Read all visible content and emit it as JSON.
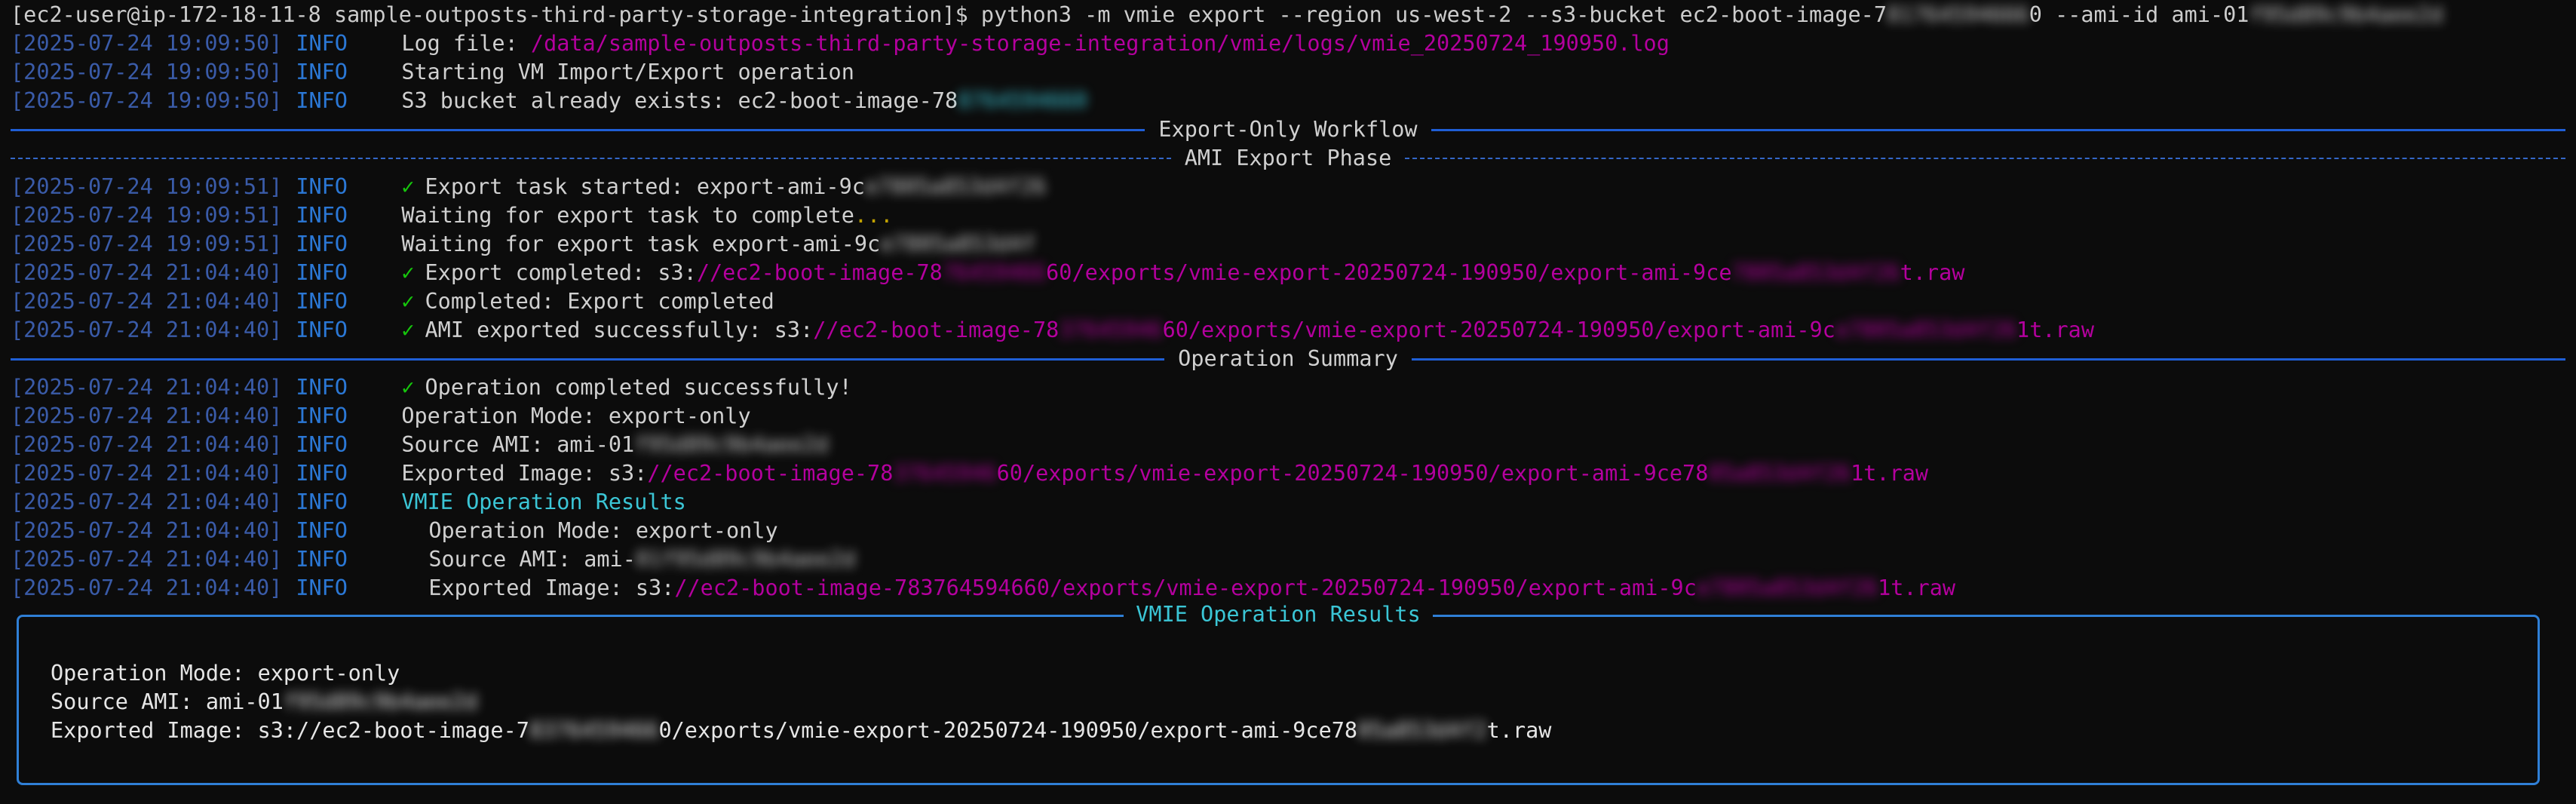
{
  "prompt": {
    "user": "[ec2-user@ip-172-18-11-8 sample-outposts-third-party-storage-integration]$",
    "command_a": "python3 -m vmie export --region us-west-2 --s3-bucket ec2-boot-image-7",
    "command_b": "0 --ami-id ami-01",
    "command_c": "f95d89c9b4aee2d"
  },
  "level": "INFO",
  "check": "✓",
  "pre": [
    {
      "ts": "[2025-07-24 19:09:50]",
      "text": "Log file: ",
      "link": "/data/sample-outposts-third-party-storage-integration/vmie/logs/vmie_20250724_190950.log"
    },
    {
      "ts": "[2025-07-24 19:09:50]",
      "text": "Starting VM Import/Export operation"
    },
    {
      "ts": "[2025-07-24 19:09:50]",
      "text": "S3 bucket already exists: ec2-boot-image-78"
    }
  ],
  "sections": {
    "workflow": "Export-Only Workflow",
    "phase": "AMI Export Phase",
    "summary": "Operation Summary"
  },
  "export_lines": {
    "l1_ts": "[2025-07-24 19:09:51]",
    "l1_text": "Export task started: export-ami-9c",
    "l2_ts": "[2025-07-24 19:09:51]",
    "l2_text": "Waiting for export task to complete",
    "l2_dots": "...",
    "l3_ts": "[2025-07-24 19:09:51]",
    "l3_text": "Waiting for export task export-ami-9c",
    "l4_ts": "[2025-07-24 21:04:40]",
    "l4_text": "Export completed: s3:",
    "l4_link_a": "//ec2-boot-image-78",
    "l4_link_b": "60/exports/vmie-export-20250724-190950/export-ami-9ce",
    "l4_link_c": "t.raw",
    "l5_ts": "[2025-07-24 21:04:40]",
    "l5_text": "Completed: Export completed",
    "l6_ts": "[2025-07-24 21:04:40]",
    "l6_text": "AMI exported successfully: s3:",
    "l6_link_a": "//ec2-boot-image-78",
    "l6_link_b": "60/exports/vmie-export-20250724-190950/export-ami-9c",
    "l6_link_c": "1t.raw"
  },
  "summary_lines": {
    "s1_ts": "[2025-07-24 21:04:40]",
    "s1_text": "Operation completed successfully!",
    "s2_ts": "[2025-07-24 21:04:40]",
    "s2_text": "Operation Mode: export-only",
    "s3_ts": "[2025-07-24 21:04:40]",
    "s3_text": "Source AMI: ami-01",
    "s4_ts": "[2025-07-24 21:04:40]",
    "s4_text": "Exported Image: s3:",
    "s4_link_a": "//ec2-boot-image-78",
    "s4_link_b": "60/exports/vmie-export-20250724-190950/export-ami-9ce78",
    "s4_link_c": "1t.raw",
    "s5_ts": "[2025-07-24 21:04:40]",
    "s5_text": "VMIE Operation Results",
    "s6_ts": "[2025-07-24 21:04:40]",
    "s6_text": "Operation Mode: export-only",
    "s7_ts": "[2025-07-24 21:04:40]",
    "s7_text": "Source AMI: ami-",
    "s8_ts": "[2025-07-24 21:04:40]",
    "s8_text": "Exported Image: s3:",
    "s8_link_a": "//ec2-boot-image-783764594660/exports/vmie-export-20250724-190950/export-ami-9c",
    "s8_link_c": "1t.raw"
  },
  "panel": {
    "title": "VMIE Operation Results",
    "mode_label": "Operation Mode:",
    "mode_value": "export-only",
    "ami_label": "Source AMI:",
    "ami_value": "ami-01",
    "image_label": "Exported Image:",
    "image_value_a": "s3://ec2-boot-image-7",
    "image_value_b": "0/exports/vmie-export-20250724-190950/export-ami-9ce78",
    "image_value_c": "t.raw"
  },
  "colors": {
    "background": "#0c0c0c",
    "info": "#2b78d6",
    "link": "#b4009e",
    "check": "#16c60c",
    "accent": "#3bc6d6",
    "rule": "#1f5fd6"
  }
}
